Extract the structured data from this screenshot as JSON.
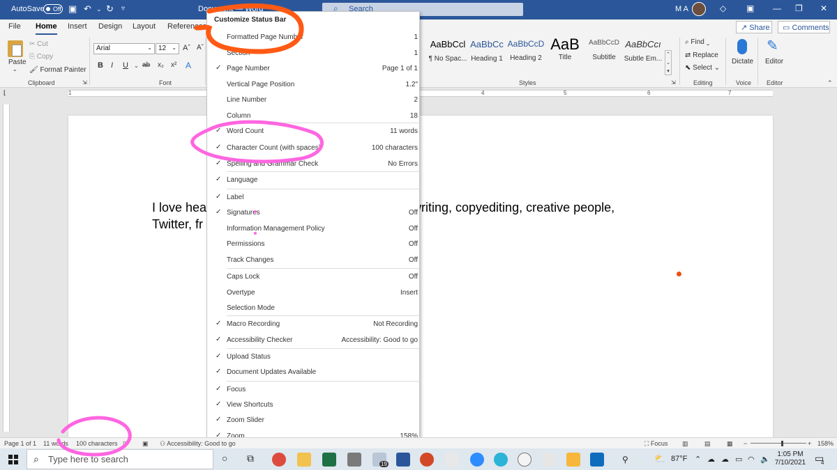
{
  "titlebar": {
    "autosave_label": "AutoSave",
    "autosave_state": "Off",
    "doc_title": "Document — Word",
    "search_placeholder": "Search",
    "user_initials": "M A"
  },
  "tabs": [
    "File",
    "Home",
    "Insert",
    "Design",
    "Layout",
    "References"
  ],
  "share_label": "Share",
  "comments_label": "Comments",
  "ribbon": {
    "paste": "Paste",
    "cut": "Cut",
    "copy": "Copy",
    "format_painter": "Format Painter",
    "clipboard": "Clipboard",
    "font_name": "Arial",
    "font_size": "12",
    "font_group": "Font",
    "bold": "B",
    "italic": "I",
    "underline": "U",
    "styles": [
      {
        "sample": "AaBbCcl",
        "name": "¶ No Spac..."
      },
      {
        "sample": "AaBbCc",
        "name": "Heading 1"
      },
      {
        "sample": "AaBbCcD",
        "name": "Heading 2"
      },
      {
        "sample": "AaB",
        "name": "Title"
      },
      {
        "sample": "AaBbCcD",
        "name": "Subtitle"
      },
      {
        "sample": "AaBbCcı",
        "name": "Subtle Em..."
      }
    ],
    "styles_group": "Styles",
    "find": "Find",
    "replace": "Replace",
    "select": "Select",
    "editing_group": "Editing",
    "dictate": "Dictate",
    "voice_group": "Voice",
    "editor": "Editor",
    "editor_group": "Editor"
  },
  "ruler_numbers": [
    "1",
    "4",
    "5",
    "6",
    "7"
  ],
  "document": {
    "line1": "I love hea",
    "line1_right": "ywriting, copyediting, creative people,",
    "line2": "Twitter, fr"
  },
  "menu": {
    "title": "Customize Status Bar",
    "items": [
      {
        "label": "Formatted Page Number",
        "value": "1",
        "checked": false
      },
      {
        "label": "Section",
        "value": "1",
        "checked": false
      },
      {
        "label": "Page Number",
        "value": "Page 1 of 1",
        "checked": true
      },
      {
        "label": "Vertical Page Position",
        "value": "1.2\"",
        "checked": false
      },
      {
        "label": "Line Number",
        "value": "2",
        "checked": false
      },
      {
        "label": "Column",
        "value": "18",
        "checked": false
      },
      {
        "label": "Word Count",
        "value": "11 words",
        "checked": true
      },
      {
        "label": "Character Count (with spaces)",
        "value": "100 characters",
        "checked": true
      },
      {
        "label": "Spelling and Grammar Check",
        "value": "No Errors",
        "checked": true
      },
      {
        "label": "Language",
        "value": "",
        "checked": true
      },
      {
        "label": "Label",
        "value": "",
        "checked": true
      },
      {
        "label": "Signatures",
        "value": "Off",
        "checked": true
      },
      {
        "label": "Information Management Policy",
        "value": "Off",
        "checked": false
      },
      {
        "label": "Permissions",
        "value": "Off",
        "checked": false
      },
      {
        "label": "Track Changes",
        "value": "Off",
        "checked": false
      },
      {
        "label": "Caps Lock",
        "value": "Off",
        "checked": false
      },
      {
        "label": "Overtype",
        "value": "Insert",
        "checked": false
      },
      {
        "label": "Selection Mode",
        "value": "",
        "checked": false
      },
      {
        "label": "Macro Recording",
        "value": "Not Recording",
        "checked": true
      },
      {
        "label": "Accessibility Checker",
        "value": "Accessibility: Good to go",
        "checked": true
      },
      {
        "label": "Upload Status",
        "value": "",
        "checked": true
      },
      {
        "label": "Document Updates Available",
        "value": "",
        "checked": true
      },
      {
        "label": "Focus",
        "value": "",
        "checked": true
      },
      {
        "label": "View Shortcuts",
        "value": "",
        "checked": true
      },
      {
        "label": "Zoom Slider",
        "value": "",
        "checked": true
      },
      {
        "label": "Zoom",
        "value": "158%",
        "checked": true
      }
    ]
  },
  "statusbar": {
    "page": "Page 1 of 1",
    "words": "11 words",
    "chars": "100 characters",
    "accessibility": "Accessibility: Good to go",
    "focus": "Focus",
    "zoom": "158%",
    "zoom_minus": "−",
    "zoom_plus": "+",
    "zoom_level": 0.55
  },
  "taskbar": {
    "search_placeholder": "Type here to search",
    "mail_badge": "19",
    "weather": "87°F",
    "time": "1:05 PM",
    "date": "7/10/2021",
    "notif_badge": "4"
  },
  "colors": {
    "word_blue": "#2b579a",
    "annotation_orange": "#ff5a14",
    "annotation_pink": "#ff66e0"
  }
}
